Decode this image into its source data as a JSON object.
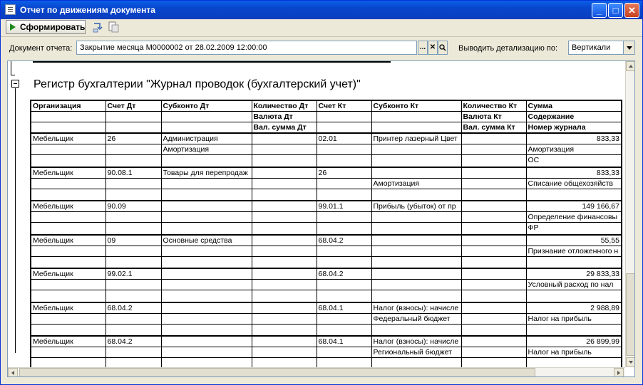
{
  "window": {
    "title": "Отчет по движениям документа",
    "controls": {
      "minimize": "_",
      "maximize": "□",
      "close": "✕"
    }
  },
  "toolbar": {
    "form_button_label": "Сформировать",
    "icons": [
      "refresh-icon",
      "document-settings-icon"
    ]
  },
  "params": {
    "doc_label": "Документ отчета:",
    "doc_value": "Закрытие месяца М0000002 от 28.02.2009 12:00:00",
    "doc_buttons": [
      "...",
      "✕",
      "🔍"
    ],
    "detail_label": "Выводить детализацию по:",
    "detail_value": "Вертикали"
  },
  "report": {
    "title": "Регистр бухгалтерии \"Журнал проводок (бухгалтерский учет)\"",
    "headers": [
      [
        "Организация",
        "Счет Дт",
        "Субконто Дт",
        "Количество Дт",
        "Счет Кт",
        "Субконто Кт",
        "Количество Кт",
        "Сумма"
      ],
      [
        "",
        "",
        "",
        "Валюта Дт",
        "",
        "",
        "Валюта Кт",
        "Содержание"
      ],
      [
        "",
        "",
        "",
        "Вал. сумма Дт",
        "",
        "",
        "Вал. сумма Кт",
        "Номер журнала"
      ]
    ],
    "rows": [
      [
        [
          "Мебельщик",
          "26",
          "Администрация",
          "",
          "02.01",
          "Принтер лазерный Цвет",
          "",
          "833,33"
        ],
        [
          "",
          "",
          "Амортизация",
          "",
          "",
          "",
          "",
          "Амортизация"
        ],
        [
          "",
          "",
          "",
          "",
          "",
          "",
          "",
          "ОС"
        ]
      ],
      [
        [
          "Мебельщик",
          "90.08.1",
          "Товары для перепродаж",
          "",
          "26",
          "",
          "",
          "833,33"
        ],
        [
          "",
          "",
          "",
          "",
          "",
          "Амортизация",
          "",
          "Списание общехозяйств"
        ],
        [
          "",
          "",
          "",
          "",
          "",
          "",
          "",
          ""
        ]
      ],
      [
        [
          "Мебельщик",
          "90.09",
          "",
          "",
          "99.01.1",
          "Прибыль (убыток) от пр",
          "",
          "149 166,67"
        ],
        [
          "",
          "",
          "",
          "",
          "",
          "",
          "",
          "Определение финансовы"
        ],
        [
          "",
          "",
          "",
          "",
          "",
          "",
          "",
          "ФР"
        ]
      ],
      [
        [
          "Мебельщик",
          "09",
          "Основные средства",
          "",
          "68.04.2",
          "",
          "",
          "55,55"
        ],
        [
          "",
          "",
          "",
          "",
          "",
          "",
          "",
          "Признание отложенного н"
        ],
        [
          "",
          "",
          "",
          "",
          "",
          "",
          "",
          ""
        ]
      ],
      [
        [
          "Мебельщик",
          "99.02.1",
          "",
          "",
          "68.04.2",
          "",
          "",
          "29 833,33"
        ],
        [
          "",
          "",
          "",
          "",
          "",
          "",
          "",
          "Условный расход по нал"
        ],
        [
          "",
          "",
          "",
          "",
          "",
          "",
          "",
          ""
        ]
      ],
      [
        [
          "Мебельщик",
          "68.04.2",
          "",
          "",
          "68.04.1",
          "Налог (взносы): начисле",
          "",
          "2 988,89"
        ],
        [
          "",
          "",
          "",
          "",
          "",
          "Федеральный бюджет",
          "",
          "Налог на прибыль"
        ],
        [
          "",
          "",
          "",
          "",
          "",
          "",
          "",
          ""
        ]
      ],
      [
        [
          "Мебельщик",
          "68.04.2",
          "",
          "",
          "68.04.1",
          "Налог (взносы): начисле",
          "",
          "26 899,99"
        ],
        [
          "",
          "",
          "",
          "",
          "",
          "Региональный бюджет",
          "",
          "Налог на прибыль"
        ],
        [
          "",
          "",
          "",
          "",
          "",
          "",
          "",
          ""
        ]
      ]
    ]
  }
}
